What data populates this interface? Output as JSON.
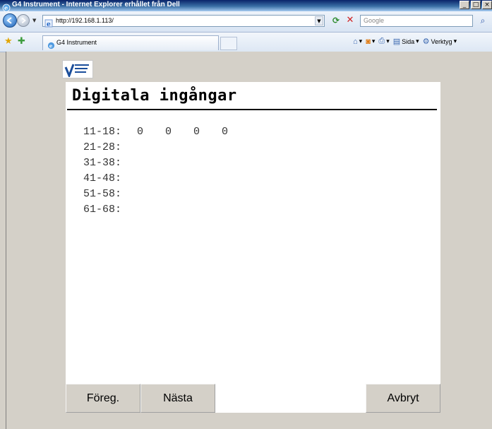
{
  "window": {
    "title": "G4 Instrument - Internet Explorer erhållet från Dell",
    "minimize": "_",
    "maximize": "□",
    "close": "×"
  },
  "addressbar": {
    "url": "http://192.168.1.113/",
    "search_placeholder": "Google"
  },
  "tabbar": {
    "tab_title": "G4 Instrument",
    "commands": {
      "page": "Sida",
      "tools": "Verktyg"
    }
  },
  "page": {
    "heading": "Digitala ingångar",
    "rows": [
      {
        "label": "11-18:",
        "values": [
          "0",
          "0",
          "0",
          "0"
        ]
      },
      {
        "label": "21-28:",
        "values": []
      },
      {
        "label": "31-38:",
        "values": []
      },
      {
        "label": "41-48:",
        "values": []
      },
      {
        "label": "51-58:",
        "values": []
      },
      {
        "label": "61-68:",
        "values": []
      }
    ],
    "buttons": {
      "prev": "Föreg.",
      "next": "Nästa",
      "cancel": "Avbryt"
    }
  },
  "colors": {
    "titlebar": "#0a246a",
    "background": "#d4d0c8",
    "panel": "#ffffff"
  }
}
